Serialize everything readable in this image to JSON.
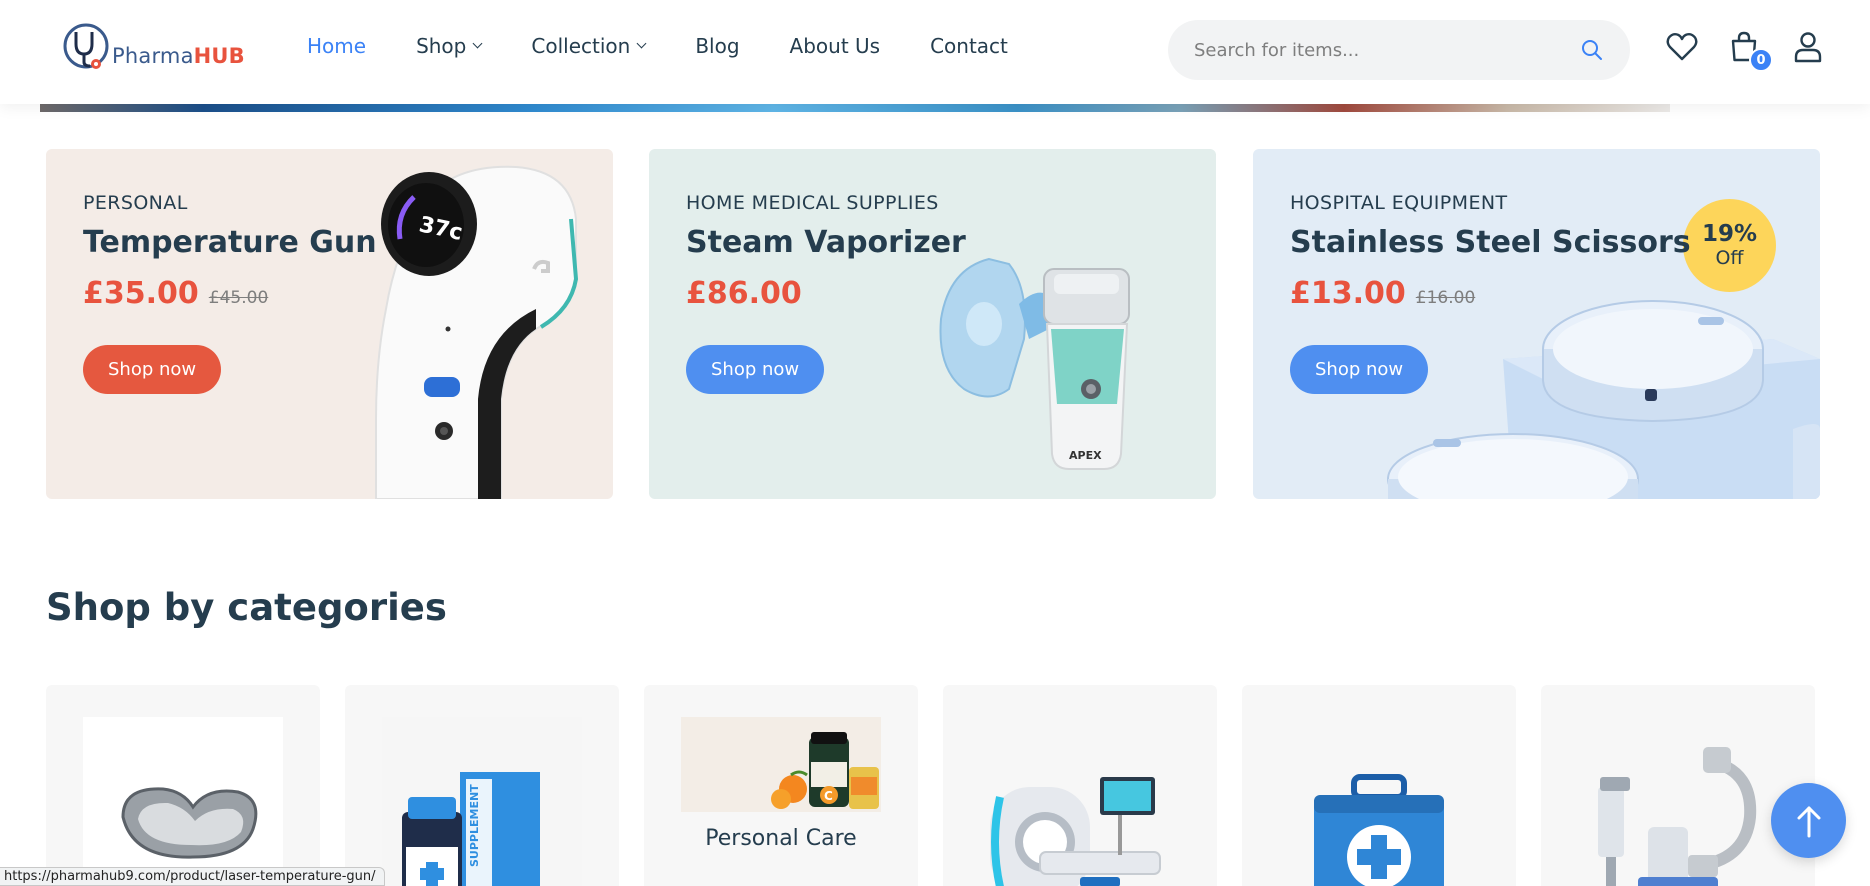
{
  "brand": {
    "name_part1": "Pharma",
    "name_part2": "HUB"
  },
  "nav": {
    "items": [
      {
        "label": "Home",
        "active": true,
        "dropdown": false
      },
      {
        "label": "Shop",
        "active": false,
        "dropdown": true
      },
      {
        "label": "Collection",
        "active": false,
        "dropdown": true
      },
      {
        "label": "Blog",
        "active": false,
        "dropdown": false
      },
      {
        "label": "About Us",
        "active": false,
        "dropdown": false
      },
      {
        "label": "Contact",
        "active": false,
        "dropdown": false
      }
    ]
  },
  "search": {
    "placeholder": "Search for items...",
    "value": ""
  },
  "header_icons": {
    "wishlist": "heart-icon",
    "cart": "shopping-bag-icon",
    "account": "user-icon",
    "cart_count": "0"
  },
  "promos": [
    {
      "category": "PERSONAL",
      "title": "Temperature Gun",
      "price": "£35.00",
      "old_price": "£45.00",
      "button": "Shop now"
    },
    {
      "category": "HOME MEDICAL SUPPLIES",
      "title": "Steam Vaporizer",
      "price": "£86.00",
      "old_price": "",
      "button": "Shop now"
    },
    {
      "category": "HOSPITAL EQUIPMENT",
      "title": "Stainless Steel Scissors",
      "price": "£13.00",
      "old_price": "£16.00",
      "button": "Shop now",
      "discount_pct": "19%",
      "discount_label": "Off"
    }
  ],
  "thermo_display": "37c",
  "categories_section": {
    "title": "Shop by categories",
    "items": [
      {
        "label": "",
        "icon": "kidney-dish-icon"
      },
      {
        "label": "",
        "icon": "supplement-bottle-icon"
      },
      {
        "label": "Personal Care",
        "icon": "vitamins-icon"
      },
      {
        "label": "",
        "icon": "mri-scanner-icon"
      },
      {
        "label": "",
        "icon": "first-aid-kit-icon"
      },
      {
        "label": "",
        "icon": "c-arm-machine-icon"
      }
    ]
  },
  "status_url": "https://pharmahub9.com/product/laser-temperature-gun/",
  "colors": {
    "accent": "#3b82f6",
    "sale": "#e8533e",
    "text": "#253d4e",
    "badge": "#fdd55a"
  }
}
